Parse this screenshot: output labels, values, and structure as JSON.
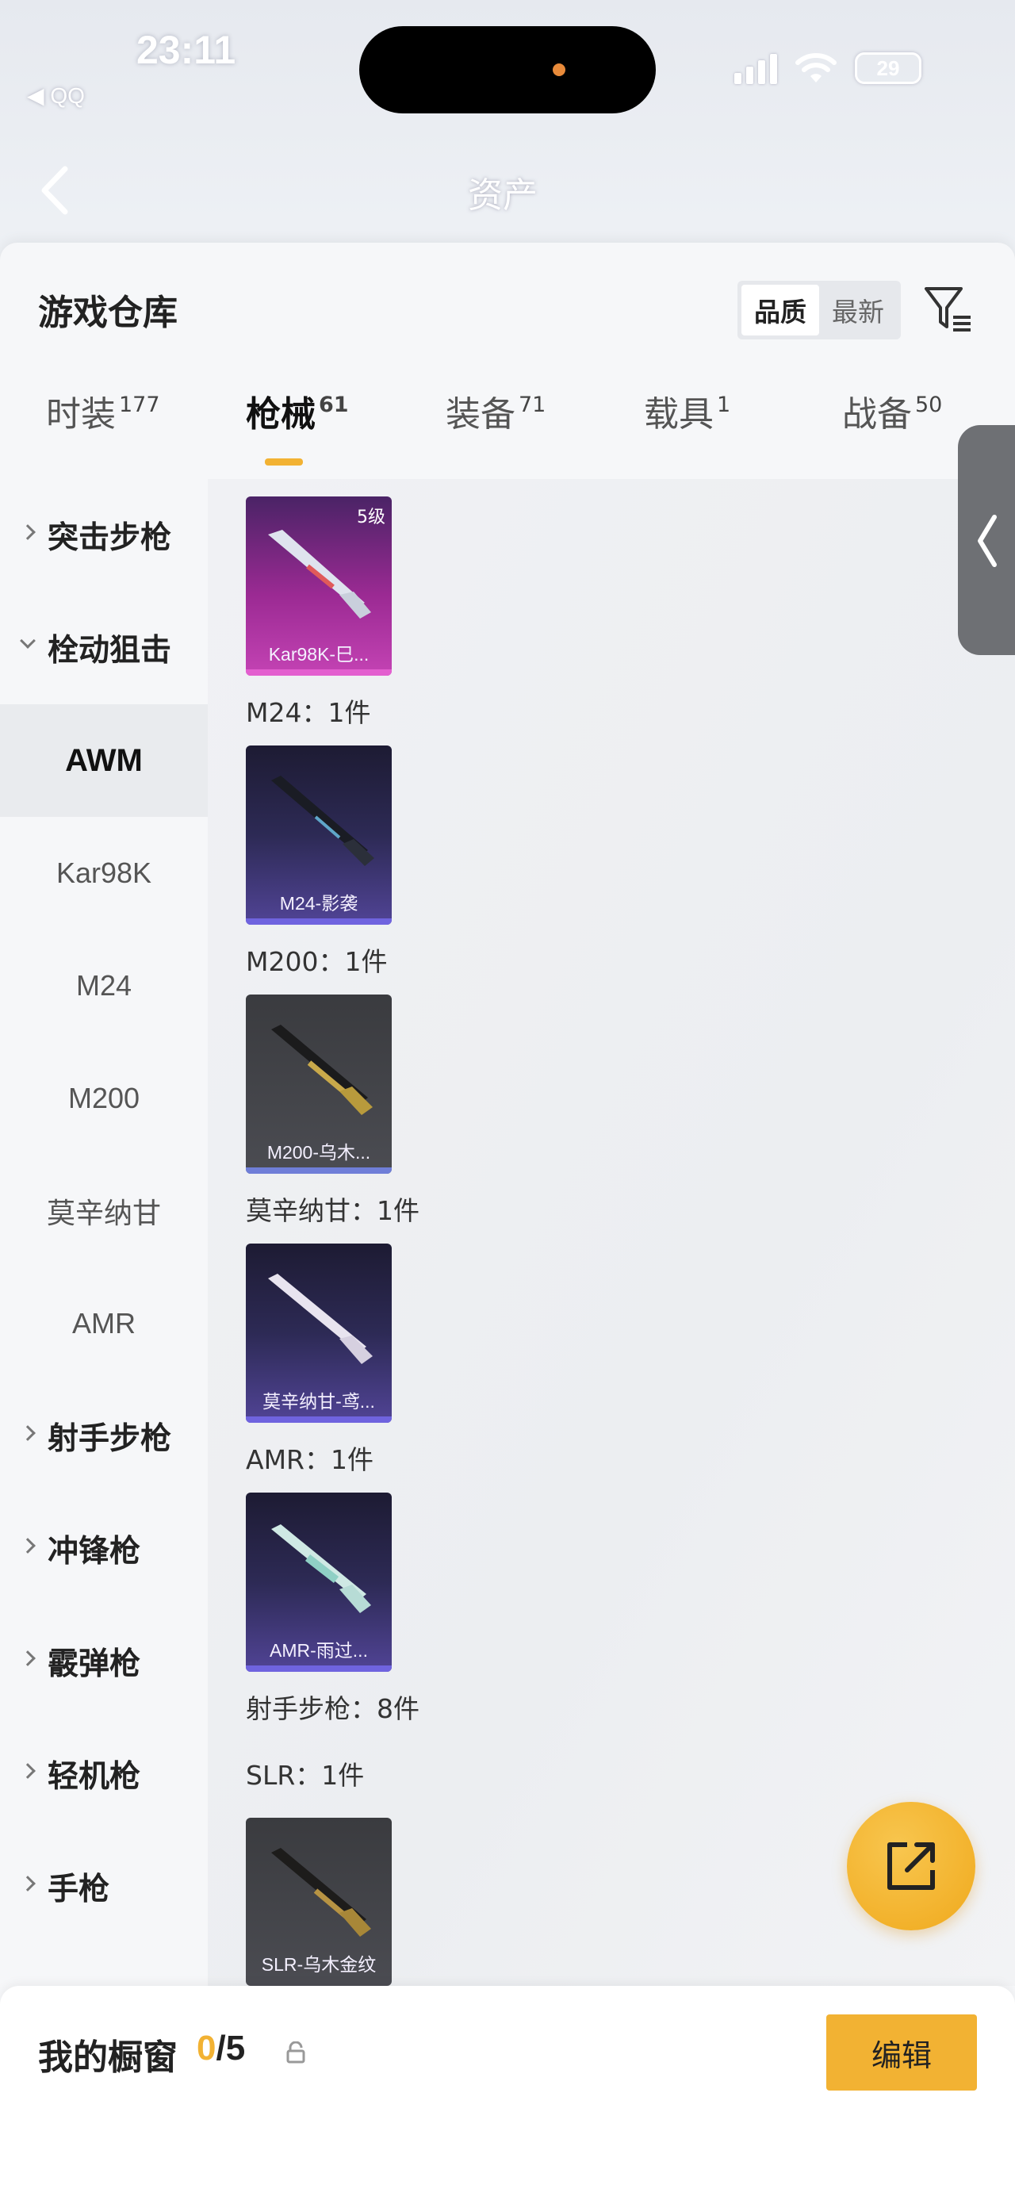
{
  "status_bar": {
    "time": "23:11",
    "back_app": "◀ QQ",
    "battery": "29",
    "icons": [
      "signal-icon",
      "wifi-icon",
      "battery-icon"
    ]
  },
  "nav": {
    "title": "资产",
    "back_icon": "chevron-left-icon"
  },
  "sheet": {
    "title": "游戏仓库",
    "sort_options": [
      "品质",
      "最新"
    ],
    "sort_selected": "品质",
    "filter_icon": "filter-icon"
  },
  "tabs": [
    {
      "label": "时装",
      "count": "177"
    },
    {
      "label": "枪械",
      "count": "61",
      "active": true
    },
    {
      "label": "装备",
      "count": "71"
    },
    {
      "label": "载具",
      "count": "1"
    },
    {
      "label": "战备",
      "count": "50"
    }
  ],
  "categories": [
    {
      "label": "突击步枪",
      "type": "group",
      "expanded": false
    },
    {
      "label": "栓动狙击",
      "type": "group",
      "expanded": true
    },
    {
      "label": "AWM",
      "type": "sub",
      "selected": true
    },
    {
      "label": "Kar98K",
      "type": "sub"
    },
    {
      "label": "M24",
      "type": "sub"
    },
    {
      "label": "M200",
      "type": "sub"
    },
    {
      "label": "莫辛纳甘",
      "type": "sub"
    },
    {
      "label": "AMR",
      "type": "sub"
    },
    {
      "label": "射手步枪",
      "type": "group",
      "expanded": false
    },
    {
      "label": "冲锋枪",
      "type": "group",
      "expanded": false
    },
    {
      "label": "霰弹枪",
      "type": "group",
      "expanded": false
    },
    {
      "label": "轻机枪",
      "type": "group",
      "expanded": false
    },
    {
      "label": "手枪",
      "type": "group",
      "expanded": false
    }
  ],
  "items": [
    {
      "name": "Kar98K-巳...",
      "level": "5级",
      "rarity": "purple"
    },
    {
      "name": "M24-影袭",
      "rarity": "violet"
    },
    {
      "name": "M200-乌木...",
      "rarity": "grey"
    },
    {
      "name": "莫辛纳甘-鸢...",
      "rarity": "violet"
    },
    {
      "name": "AMR-雨过...",
      "rarity": "violet"
    },
    {
      "name": "SLR-乌木金纹",
      "rarity": "grey"
    }
  ],
  "count_labels": [
    {
      "text": "M24：1件"
    },
    {
      "text": "M200：1件"
    },
    {
      "text": "莫辛纳甘：1件"
    },
    {
      "text": "AMR：1件"
    },
    {
      "text": "射手步枪：8件"
    },
    {
      "text": "SLR：1件"
    }
  ],
  "showcase": {
    "title": "我的橱窗",
    "used": "0",
    "total": "/5",
    "edit_label": "编辑"
  },
  "colors": {
    "accent": "#f2b233",
    "rarity_purple": "#c443b4",
    "rarity_violet": "#514496",
    "rarity_grey": "#4b4c52"
  }
}
